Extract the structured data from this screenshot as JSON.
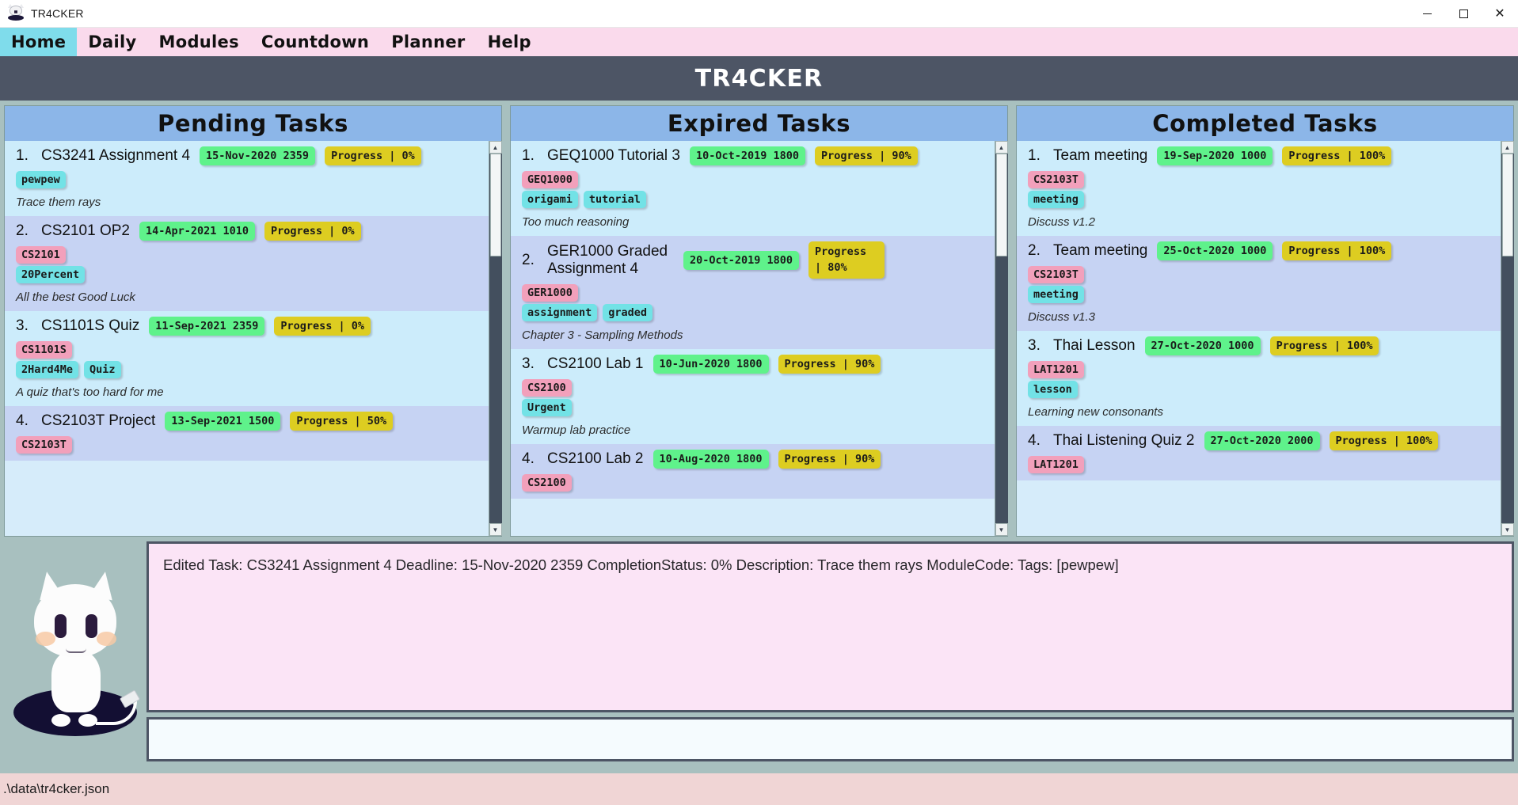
{
  "window": {
    "title": "TR4CKER",
    "icon": "cat-icon",
    "controls": {
      "minimize": "minimize-icon",
      "maximize": "maximize-icon",
      "close": "close-icon"
    }
  },
  "menubar": {
    "items": [
      {
        "label": "Home",
        "active": true
      },
      {
        "label": "Daily",
        "active": false
      },
      {
        "label": "Modules",
        "active": false
      },
      {
        "label": "Countdown",
        "active": false
      },
      {
        "label": "Planner",
        "active": false
      },
      {
        "label": "Help",
        "active": false
      }
    ]
  },
  "header": {
    "brand": "TR4CKER"
  },
  "columns": [
    {
      "id": "pending",
      "title": "Pending Tasks",
      "has_scrollbar": true,
      "scroll_up_icon": "chevron-up-icon",
      "scroll_down_icon": "chevron-down-icon",
      "tasks": [
        {
          "index": "1.",
          "title": "CS3241 Assignment 4",
          "deadline": "15-Nov-2020 2359",
          "progress": "Progress | 0%",
          "module_tag": "",
          "tags": [
            "pewpew"
          ],
          "description": "Trace them rays"
        },
        {
          "index": "2.",
          "title": "CS2101 OP2",
          "deadline": "14-Apr-2021 1010",
          "progress": "Progress | 0%",
          "module_tag": "CS2101",
          "tags": [
            "20Percent"
          ],
          "description": "All the best Good Luck"
        },
        {
          "index": "3.",
          "title": "CS1101S Quiz",
          "deadline": "11-Sep-2021 2359",
          "progress": "Progress | 0%",
          "module_tag": "CS1101S",
          "tags": [
            "2Hard4Me",
            "Quiz"
          ],
          "description": "A quiz that's too hard for me"
        },
        {
          "index": "4.",
          "title": "CS2103T Project",
          "deadline": "13-Sep-2021 1500",
          "progress": "Progress | 50%",
          "module_tag": "CS2103T",
          "tags": [],
          "description": ""
        }
      ]
    },
    {
      "id": "expired",
      "title": "Expired Tasks",
      "has_scrollbar": true,
      "scroll_up_icon": "chevron-up-icon",
      "scroll_down_icon": "chevron-down-icon",
      "tasks": [
        {
          "index": "1.",
          "title": "GEQ1000 Tutorial 3",
          "deadline": "10-Oct-2019 1800",
          "progress": "Progress | 90%",
          "module_tag": "GEQ1000",
          "tags": [
            "origami",
            "tutorial"
          ],
          "description": "Too much reasoning"
        },
        {
          "index": "2.",
          "title": "GER1000 Graded Assignment 4",
          "deadline": "20-Oct-2019 1800",
          "progress": "Progress | 80%",
          "module_tag": "GER1000",
          "tags": [
            "assignment",
            "graded"
          ],
          "description": "Chapter 3 - Sampling Methods",
          "wrap_title": true,
          "wrap_pills": true
        },
        {
          "index": "3.",
          "title": "CS2100 Lab 1",
          "deadline": "10-Jun-2020 1800",
          "progress": "Progress | 90%",
          "module_tag": "CS2100",
          "tags": [
            "Urgent"
          ],
          "description": "Warmup lab practice"
        },
        {
          "index": "4.",
          "title": "CS2100 Lab 2",
          "deadline": "10-Aug-2020 1800",
          "progress": "Progress | 90%",
          "module_tag": "CS2100",
          "tags": [],
          "description": ""
        }
      ]
    },
    {
      "id": "completed",
      "title": "Completed Tasks",
      "has_scrollbar": true,
      "scroll_up_icon": "chevron-up-icon",
      "scroll_down_icon": "chevron-down-icon",
      "tasks": [
        {
          "index": "1.",
          "title": "Team meeting",
          "deadline": "19-Sep-2020 1000",
          "progress": "Progress | 100%",
          "module_tag": "CS2103T",
          "tags": [
            "meeting"
          ],
          "description": "Discuss v1.2"
        },
        {
          "index": "2.",
          "title": "Team meeting",
          "deadline": "25-Oct-2020 1000",
          "progress": "Progress | 100%",
          "module_tag": "CS2103T",
          "tags": [
            "meeting"
          ],
          "description": "Discuss v1.3"
        },
        {
          "index": "3.",
          "title": "Thai Lesson",
          "deadline": "27-Oct-2020 1000",
          "progress": "Progress | 100%",
          "module_tag": "LAT1201",
          "tags": [
            "lesson"
          ],
          "description": "Learning new consonants"
        },
        {
          "index": "4.",
          "title": "Thai Listening Quiz 2",
          "deadline": "27-Oct-2020 2000",
          "progress": "Progress | 100%",
          "module_tag": "LAT1201",
          "tags": [],
          "description": ""
        }
      ]
    }
  ],
  "result": {
    "text": "Edited Task: CS3241 Assignment 4 Deadline: 15-Nov-2020 2359 CompletionStatus: 0% Description: Trace them rays ModuleCode:  Tags: [pewpew]"
  },
  "command": {
    "value": "",
    "placeholder": ""
  },
  "statusbar": {
    "path": ".\\data\\tr4cker.json"
  },
  "colors": {
    "menubar_bg": "#fadaec",
    "active_tab": "#7fdceb",
    "header_bg": "#4d5565",
    "column_title_bg": "#8cb6e8",
    "deadline_pill": "#5ff28b",
    "progress_pill": "#ddcd21",
    "module_tag": "#f2a0bb",
    "normal_tag": "#72e2e6",
    "row_even": "#ccecfb",
    "row_odd": "#c6d3f3",
    "page_bg": "#a8c0bf",
    "result_bg": "#fbe4f6",
    "statusbar_bg": "#f0d5d5"
  }
}
